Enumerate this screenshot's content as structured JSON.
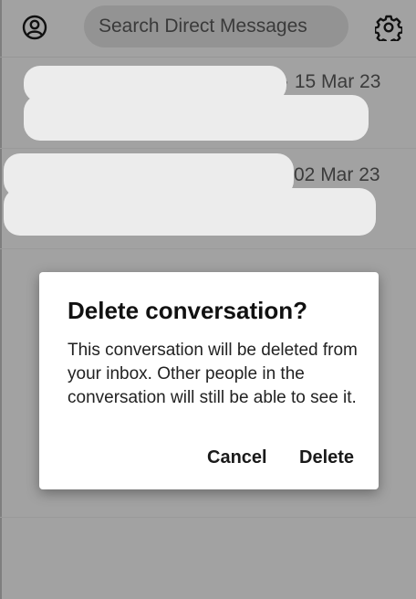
{
  "search": {
    "placeholder": "Search Direct Messages"
  },
  "conversations": [
    {
      "date": "· 15 Mar 23"
    },
    {
      "date": "02 Mar 23"
    }
  ],
  "dialog": {
    "title": "Delete conversation?",
    "message": "This conversation will be deleted from your inbox. Other people in the conversation will still be able to see it.",
    "cancel_label": "Cancel",
    "delete_label": "Delete"
  },
  "icons": {
    "profile": "profile-icon",
    "settings": "gear-icon"
  },
  "colors": {
    "overlay_background": "#a2a2a2",
    "dialog_background": "#ffffff"
  }
}
